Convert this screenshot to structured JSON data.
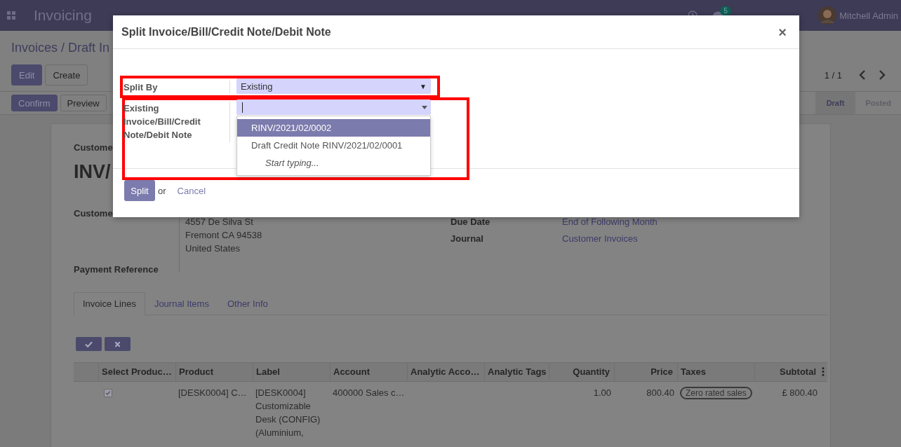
{
  "navbar": {
    "app_name": "Invoicing",
    "message_count": "5",
    "user": "Mitchell Admin"
  },
  "breadcrumb": "Invoices / Draft In",
  "control_buttons": [
    {
      "label": "Edit",
      "kind": "primary"
    },
    {
      "label": "Create",
      "kind": "secondary"
    }
  ],
  "pager": "1 / 1",
  "action_buttons": [
    {
      "label": "Confirm",
      "kind": "primary"
    },
    {
      "label": "Preview",
      "kind": "secondary"
    }
  ],
  "status_steps": [
    {
      "label": "Draft",
      "selected": true
    },
    {
      "label": "Posted",
      "selected": false
    }
  ],
  "form": {
    "customer_label": "Custome",
    "number": "INV/",
    "partner_label": "Custome",
    "address": [
      "4557 De Silva St",
      "Fremont CA 94538",
      "United States"
    ],
    "payment_reference_label": "Payment Reference",
    "fields": [
      {
        "label": "Due Date",
        "value": "End of Following Month"
      },
      {
        "label": "Journal",
        "value": "Customer Invoices"
      }
    ]
  },
  "tabs": [
    {
      "label": "Invoice Lines",
      "selected": true
    },
    {
      "label": "Journal Items",
      "selected": false
    },
    {
      "label": "Other Info",
      "selected": false
    }
  ],
  "table": {
    "columns": [
      "Select Produc…",
      "Product",
      "Label",
      "Account",
      "Analytic Acco…",
      "Analytic Tags",
      "Quantity",
      "Price",
      "Taxes",
      "Subtotal"
    ],
    "rows": [
      {
        "checked": true,
        "product": "[DESK0004] C…",
        "label": "[DESK0004] Customizable Desk (CONFIG) (Aluminium,",
        "account": "400000 Sales c…",
        "quantity": "1.00",
        "price": "800.40",
        "taxes": [
          "Zero rated sales"
        ],
        "subtotal": "£ 800.40"
      }
    ]
  },
  "dialog": {
    "title": "Split Invoice/Bill/Credit Note/Debit Note",
    "close": "×",
    "split_by_label": "Split By",
    "split_by_value": "Existing",
    "split_by_arrow": "▼",
    "existing_label": "Existing Invoice/Bill/Credit Note/Debit Note",
    "options": [
      {
        "label": "RINV/2021/02/0002",
        "selected": true
      },
      {
        "label": "Draft Credit Note RINV/2021/02/0001",
        "selected": false
      }
    ],
    "hint": "Start typing...",
    "split_button": "Split",
    "or": "or",
    "cancel": "Cancel"
  }
}
